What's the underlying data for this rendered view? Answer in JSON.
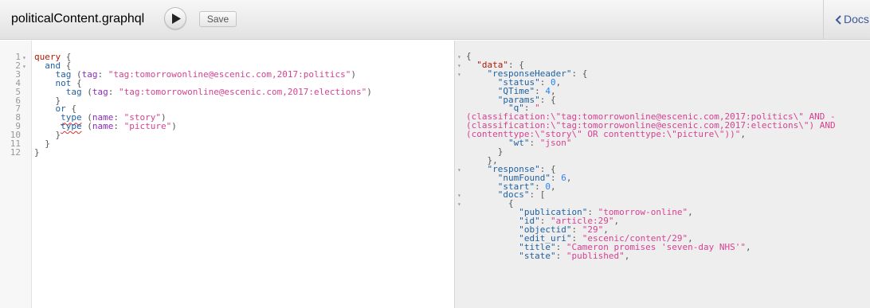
{
  "toolbar": {
    "title": "politicalContent.graphql",
    "save_label": "Save",
    "docs_label": "Docs"
  },
  "query_lines": [
    {
      "num": "1",
      "fold": "▾",
      "parts": [
        {
          "t": "query",
          "c": "kw"
        },
        {
          "t": " {",
          "c": "pun"
        }
      ]
    },
    {
      "num": "2",
      "fold": "▾",
      "parts": [
        {
          "t": "  and",
          "c": "fld"
        },
        {
          "t": " {",
          "c": "pun"
        }
      ]
    },
    {
      "num": "3",
      "fold": "",
      "parts": [
        {
          "t": "    tag",
          "c": "fld"
        },
        {
          "t": " (",
          "c": "pun"
        },
        {
          "t": "tag",
          "c": "arg"
        },
        {
          "t": ": ",
          "c": "pun"
        },
        {
          "t": "\"tag:tomorrowonline@escenic.com,2017:politics\"",
          "c": "str"
        },
        {
          "t": ")",
          "c": "pun"
        }
      ]
    },
    {
      "num": "4",
      "fold": "",
      "parts": [
        {
          "t": "    not",
          "c": "fld"
        },
        {
          "t": " {",
          "c": "pun"
        }
      ]
    },
    {
      "num": "5",
      "fold": "",
      "parts": [
        {
          "t": "      tag",
          "c": "fld"
        },
        {
          "t": " (",
          "c": "pun"
        },
        {
          "t": "tag",
          "c": "arg"
        },
        {
          "t": ": ",
          "c": "pun"
        },
        {
          "t": "\"tag:tomorrowonline@escenic.com,2017:elections\"",
          "c": "str"
        },
        {
          "t": ")",
          "c": "pun"
        }
      ]
    },
    {
      "num": "6",
      "fold": "",
      "parts": [
        {
          "t": "    }",
          "c": "pun"
        }
      ]
    },
    {
      "num": "7",
      "fold": "",
      "parts": [
        {
          "t": "    or",
          "c": "fld"
        },
        {
          "t": " {",
          "c": "pun"
        }
      ]
    },
    {
      "num": "8",
      "fold": "",
      "parts": [
        {
          "t": "     ",
          "c": "pun"
        },
        {
          "t": "type",
          "c": "fld sq"
        },
        {
          "t": " (",
          "c": "pun"
        },
        {
          "t": "name",
          "c": "arg"
        },
        {
          "t": ": ",
          "c": "pun"
        },
        {
          "t": "\"story\"",
          "c": "str"
        },
        {
          "t": ")",
          "c": "pun"
        }
      ]
    },
    {
      "num": "9",
      "fold": "",
      "parts": [
        {
          "t": "     ",
          "c": "pun"
        },
        {
          "t": "type",
          "c": "fld sq"
        },
        {
          "t": " (",
          "c": "pun"
        },
        {
          "t": "name",
          "c": "arg"
        },
        {
          "t": ": ",
          "c": "pun"
        },
        {
          "t": "\"picture\"",
          "c": "str"
        },
        {
          "t": ")",
          "c": "pun"
        }
      ]
    },
    {
      "num": "10",
      "fold": "",
      "parts": [
        {
          "t": "    }",
          "c": "pun"
        }
      ]
    },
    {
      "num": "11",
      "fold": "",
      "parts": [
        {
          "t": "  }",
          "c": "pun"
        }
      ]
    },
    {
      "num": "12",
      "fold": "",
      "parts": [
        {
          "t": "}",
          "c": "pun"
        }
      ]
    }
  ],
  "result_lines": [
    {
      "fold": "▾",
      "parts": [
        {
          "t": "{",
          "c": "pun"
        }
      ]
    },
    {
      "fold": "▾",
      "parts": [
        {
          "t": "  ",
          "c": "pun"
        },
        {
          "t": "\"data\"",
          "c": "kw"
        },
        {
          "t": ": {",
          "c": "pun"
        }
      ]
    },
    {
      "fold": "▾",
      "parts": [
        {
          "t": "    ",
          "c": "pun"
        },
        {
          "t": "\"responseHeader\"",
          "c": "key"
        },
        {
          "t": ": {",
          "c": "pun"
        }
      ]
    },
    {
      "fold": "",
      "parts": [
        {
          "t": "      ",
          "c": "pun"
        },
        {
          "t": "\"status\"",
          "c": "key"
        },
        {
          "t": ": ",
          "c": "pun"
        },
        {
          "t": "0",
          "c": "num"
        },
        {
          "t": ",",
          "c": "pun"
        }
      ]
    },
    {
      "fold": "",
      "parts": [
        {
          "t": "      ",
          "c": "pun"
        },
        {
          "t": "\"QTime\"",
          "c": "key"
        },
        {
          "t": ": ",
          "c": "pun"
        },
        {
          "t": "4",
          "c": "num"
        },
        {
          "t": ",",
          "c": "pun"
        }
      ]
    },
    {
      "fold": "",
      "parts": [
        {
          "t": "      ",
          "c": "pun"
        },
        {
          "t": "\"params\"",
          "c": "key"
        },
        {
          "t": ": {",
          "c": "pun"
        }
      ]
    },
    {
      "fold": "",
      "parts": [
        {
          "t": "        ",
          "c": "pun"
        },
        {
          "t": "\"q\"",
          "c": "key"
        },
        {
          "t": ": ",
          "c": "pun"
        },
        {
          "t": "\"",
          "c": "str"
        }
      ]
    },
    {
      "fold": "",
      "parts": [
        {
          "t": "(classification:\\\"tag:tomorrowonline@escenic.com,2017:politics\\\" AND -",
          "c": "str"
        }
      ]
    },
    {
      "fold": "",
      "parts": [
        {
          "t": "(classification:\\\"tag:tomorrowonline@escenic.com,2017:elections\\\") AND",
          "c": "str"
        }
      ]
    },
    {
      "fold": "",
      "parts": [
        {
          "t": "(contenttype:\\\"story\\\" OR contenttype:\\\"picture\\\"))\"",
          "c": "str"
        },
        {
          "t": ",",
          "c": "pun"
        }
      ]
    },
    {
      "fold": "",
      "parts": [
        {
          "t": "        ",
          "c": "pun"
        },
        {
          "t": "\"wt\"",
          "c": "key"
        },
        {
          "t": ": ",
          "c": "pun"
        },
        {
          "t": "\"json\"",
          "c": "str"
        }
      ]
    },
    {
      "fold": "",
      "parts": [
        {
          "t": "      }",
          "c": "pun"
        }
      ]
    },
    {
      "fold": "",
      "parts": [
        {
          "t": "    },",
          "c": "pun"
        }
      ]
    },
    {
      "fold": "▾",
      "parts": [
        {
          "t": "    ",
          "c": "pun"
        },
        {
          "t": "\"response\"",
          "c": "key"
        },
        {
          "t": ": {",
          "c": "pun"
        }
      ]
    },
    {
      "fold": "",
      "parts": [
        {
          "t": "      ",
          "c": "pun"
        },
        {
          "t": "\"numFound\"",
          "c": "key"
        },
        {
          "t": ": ",
          "c": "pun"
        },
        {
          "t": "6",
          "c": "num"
        },
        {
          "t": ",",
          "c": "pun"
        }
      ]
    },
    {
      "fold": "",
      "parts": [
        {
          "t": "      ",
          "c": "pun"
        },
        {
          "t": "\"start\"",
          "c": "key"
        },
        {
          "t": ": ",
          "c": "pun"
        },
        {
          "t": "0",
          "c": "num"
        },
        {
          "t": ",",
          "c": "pun"
        }
      ]
    },
    {
      "fold": "▾",
      "parts": [
        {
          "t": "      ",
          "c": "pun"
        },
        {
          "t": "\"docs\"",
          "c": "key"
        },
        {
          "t": ": [",
          "c": "pun"
        }
      ]
    },
    {
      "fold": "▾",
      "parts": [
        {
          "t": "        {",
          "c": "pun"
        }
      ]
    },
    {
      "fold": "",
      "parts": [
        {
          "t": "          ",
          "c": "pun"
        },
        {
          "t": "\"publication\"",
          "c": "key"
        },
        {
          "t": ": ",
          "c": "pun"
        },
        {
          "t": "\"tomorrow-online\"",
          "c": "str"
        },
        {
          "t": ",",
          "c": "pun"
        }
      ]
    },
    {
      "fold": "",
      "parts": [
        {
          "t": "          ",
          "c": "pun"
        },
        {
          "t": "\"id\"",
          "c": "key"
        },
        {
          "t": ": ",
          "c": "pun"
        },
        {
          "t": "\"article:29\"",
          "c": "str"
        },
        {
          "t": ",",
          "c": "pun"
        }
      ]
    },
    {
      "fold": "",
      "parts": [
        {
          "t": "          ",
          "c": "pun"
        },
        {
          "t": "\"objectid\"",
          "c": "key"
        },
        {
          "t": ": ",
          "c": "pun"
        },
        {
          "t": "\"29\"",
          "c": "str"
        },
        {
          "t": ",",
          "c": "pun"
        }
      ]
    },
    {
      "fold": "",
      "parts": [
        {
          "t": "          ",
          "c": "pun"
        },
        {
          "t": "\"edit_uri\"",
          "c": "key"
        },
        {
          "t": ": ",
          "c": "pun"
        },
        {
          "t": "\"escenic/content/29\"",
          "c": "str"
        },
        {
          "t": ",",
          "c": "pun"
        }
      ]
    },
    {
      "fold": "",
      "parts": [
        {
          "t": "          ",
          "c": "pun"
        },
        {
          "t": "\"title\"",
          "c": "key"
        },
        {
          "t": ": ",
          "c": "pun"
        },
        {
          "t": "\"Cameron promises 'seven-day NHS'\"",
          "c": "str"
        },
        {
          "t": ",",
          "c": "pun"
        }
      ]
    },
    {
      "fold": "",
      "parts": [
        {
          "t": "          ",
          "c": "pun"
        },
        {
          "t": "\"state\"",
          "c": "key"
        },
        {
          "t": ": ",
          "c": "pun"
        },
        {
          "t": "\"published\"",
          "c": "str"
        },
        {
          "t": ",",
          "c": "pun"
        }
      ]
    }
  ]
}
